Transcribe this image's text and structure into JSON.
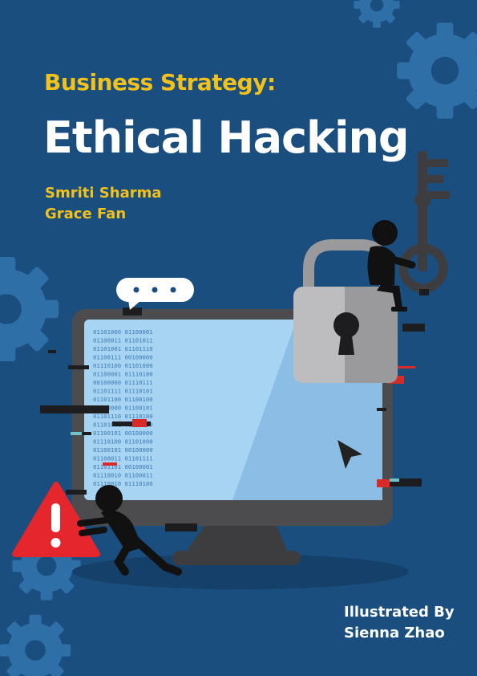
{
  "cover": {
    "series_title": "Business Strategy:",
    "title": "Ethical Hacking",
    "authors": [
      "Smriti Sharma",
      "Grace Fan"
    ],
    "illustrator_label": "Illustrated By",
    "illustrator": "Sienna Zhao"
  },
  "screen_binary": [
    "01101000 01100001",
    "01100011 01101011",
    "01101001 01101110",
    "01100111 00100000",
    "01110100 01101000",
    "01100001 01110100",
    "00100000 01110111",
    "01101111 01110101",
    "01101100 01100100",
    "00100000 01100101",
    "01101110 01110100",
    "01101001 01101100",
    "01100101 00100000",
    "01110100 01101000",
    "01100101 00100000",
    "01100011 01101111",
    "01101101 00100001",
    "01110010 01100011",
    "01110010 01110100"
  ],
  "icons": [
    "gear-icon",
    "speech-bubble-icon",
    "padlock-icon",
    "key-icon",
    "cursor-icon",
    "warning-icon"
  ],
  "colors": {
    "background": "#1a4e7e",
    "accent_yellow": "#f2c21b",
    "title_white": "#ffffff",
    "gear": "#2e6fa8",
    "screen": "#a7d4f2",
    "warning_red": "#e5262c",
    "glitch_red": "#d92a2a",
    "glitch_teal": "#6fc3c9"
  }
}
